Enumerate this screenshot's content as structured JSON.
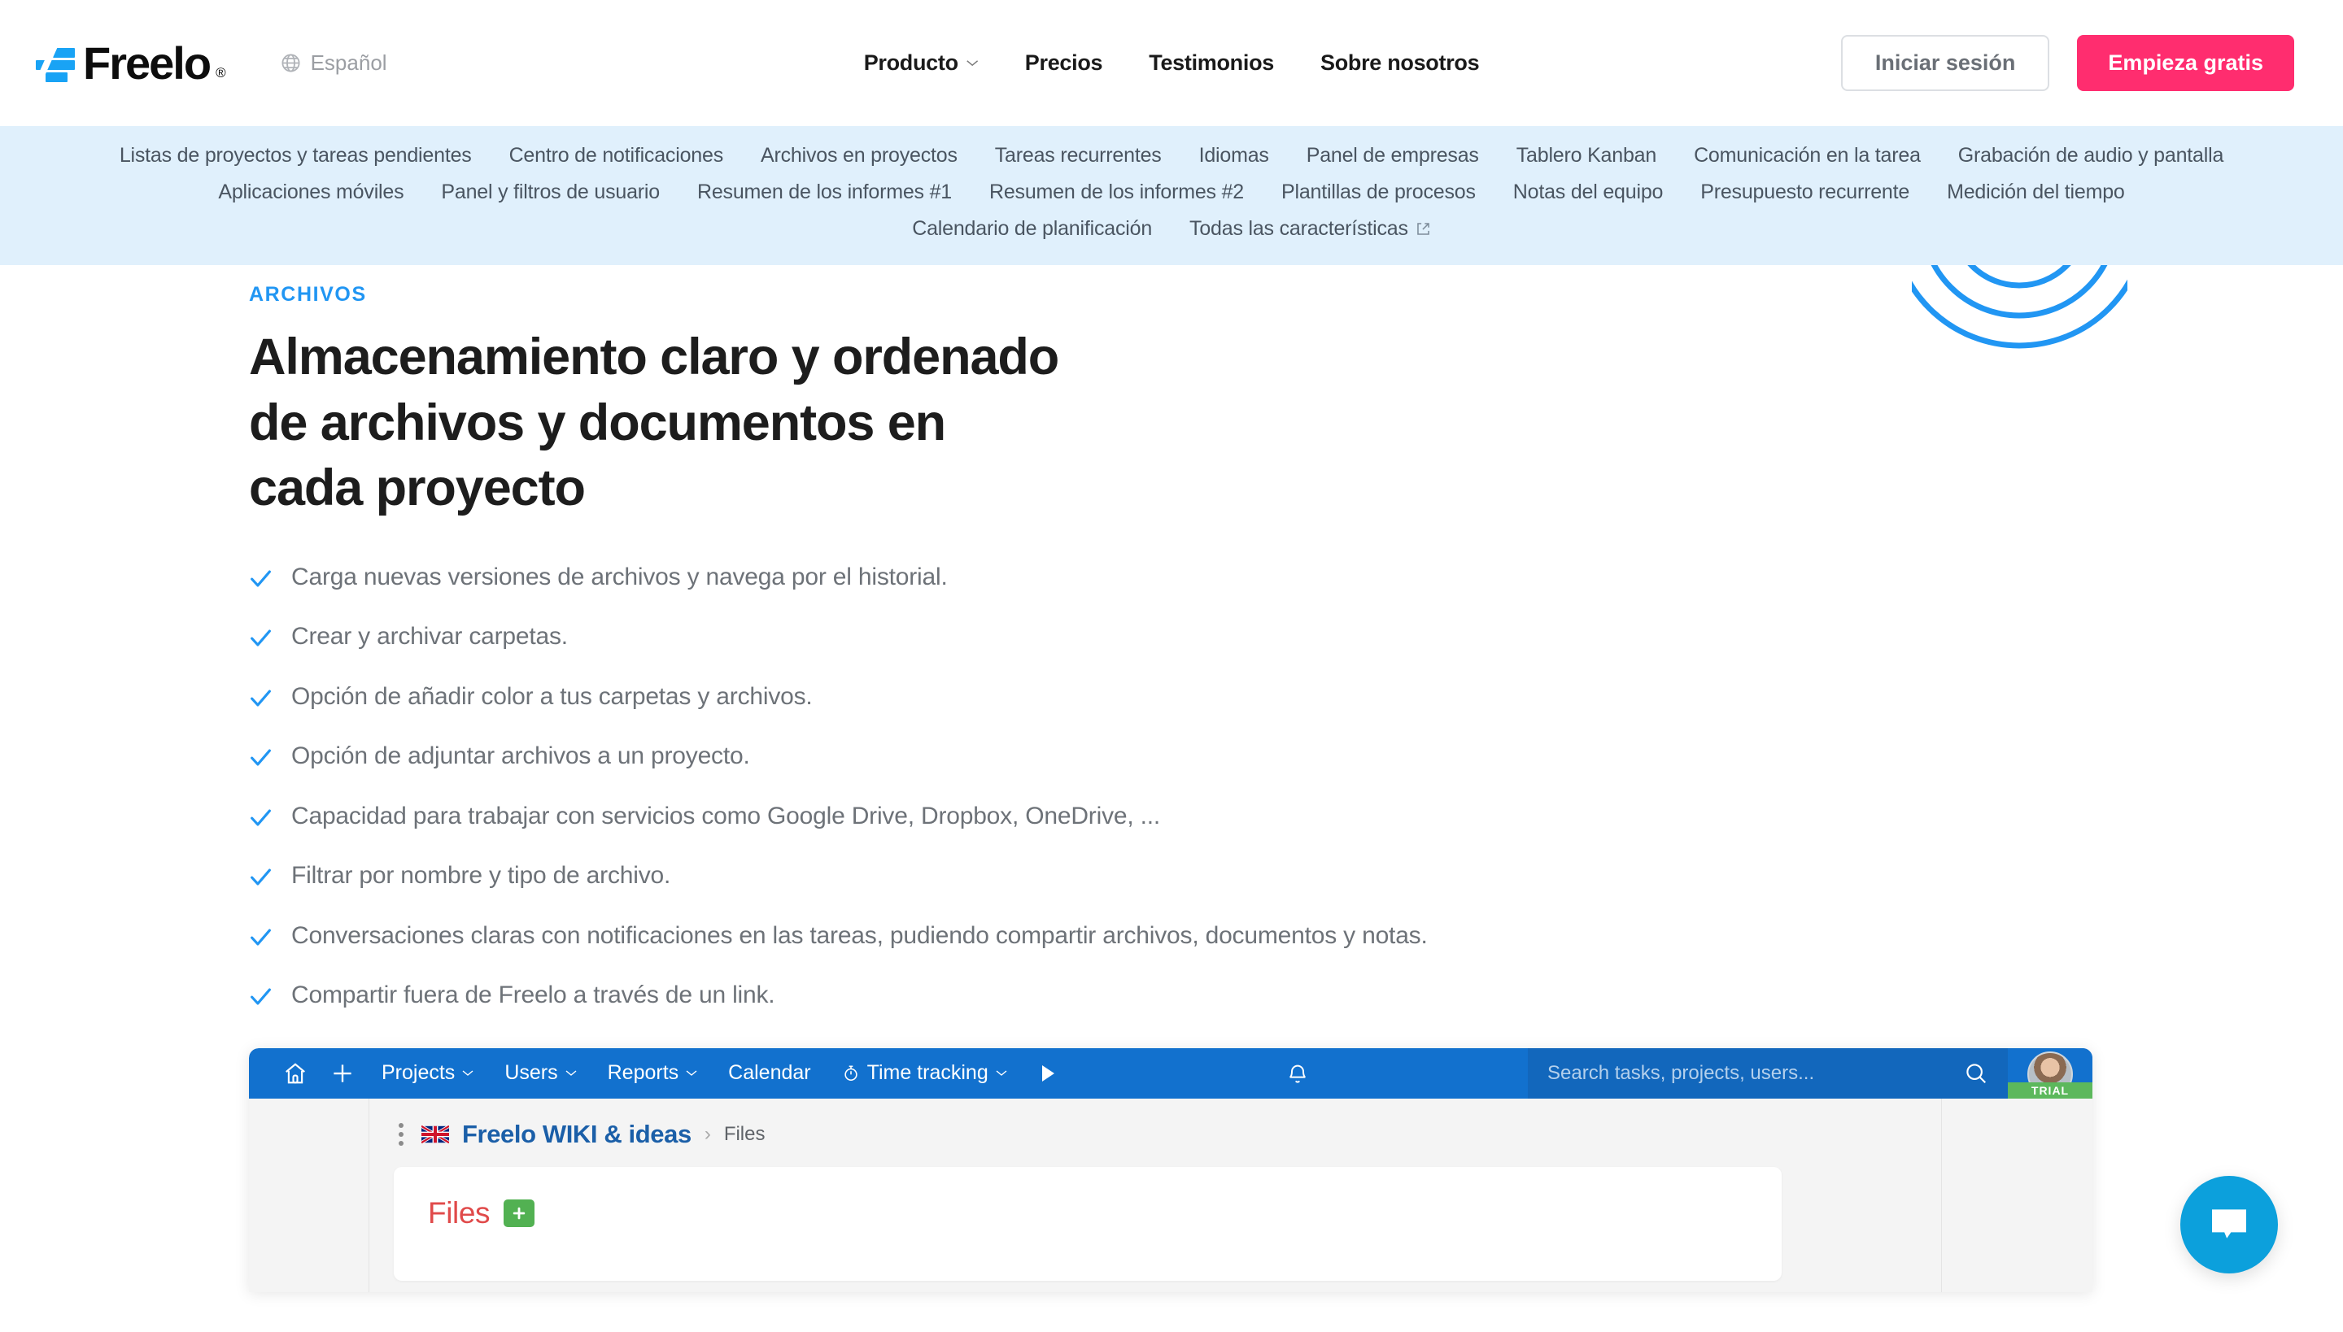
{
  "header": {
    "logo_text": "Freelo",
    "logo_registered": "®",
    "language": "Español",
    "nav": [
      {
        "label": "Producto",
        "has_dropdown": true
      },
      {
        "label": "Precios",
        "has_dropdown": false
      },
      {
        "label": "Testimonios",
        "has_dropdown": false
      },
      {
        "label": "Sobre nosotros",
        "has_dropdown": false
      }
    ],
    "login_label": "Iniciar sesión",
    "cta_label": "Empieza gratis"
  },
  "subnav": {
    "row1": [
      "Listas de proyectos y tareas pendientes",
      "Centro de notificaciones",
      "Archivos en proyectos",
      "Tareas recurrentes",
      "Idiomas",
      "Panel de empresas",
      "Tablero Kanban",
      "Comunicación en la tarea",
      "Grabación de audio y pantalla"
    ],
    "row2": [
      "Aplicaciones móviles",
      "Panel y filtros de usuario",
      "Resumen de los informes #1",
      "Resumen de los informes #2",
      "Plantillas de procesos",
      "Notas del equipo",
      "Presupuesto recurrente",
      "Medición del tiempo"
    ],
    "row3": [
      "Calendario de planificación"
    ],
    "row3_external": "Todas las características"
  },
  "hero": {
    "eyebrow": "ARCHIVOS",
    "title": "Almacenamiento claro y ordenado de archivos y documentos en cada proyecto",
    "features": [
      "Carga nuevas versiones de archivos y navega por el historial.",
      "Crear y archivar carpetas.",
      "Opción de añadir color a tus carpetas y archivos.",
      "Opción de adjuntar archivos a un proyecto.",
      "Capacidad para trabajar con servicios como Google Drive, Dropbox, OneDrive, ...",
      "Filtrar por nombre y tipo de archivo.",
      "Conversaciones claras con notificaciones en las tareas, pudiendo compartir archivos, documentos y notas.",
      "Compartir fuera de Freelo a través de un link."
    ]
  },
  "app": {
    "toolbar": [
      {
        "label": "Projects",
        "dropdown": true
      },
      {
        "label": "Users",
        "dropdown": true
      },
      {
        "label": "Reports",
        "dropdown": true
      },
      {
        "label": "Calendar",
        "dropdown": false
      },
      {
        "label": "Time tracking",
        "dropdown": true
      }
    ],
    "search_placeholder": "Search tasks, projects, users...",
    "trial_badge": "TRIAL",
    "breadcrumb_project": "Freelo WIKI & ideas",
    "breadcrumb_separator": "›",
    "breadcrumb_current": "Files",
    "files_title": "Files"
  },
  "colors": {
    "brand_blue": "#19A3F5",
    "cta_pink": "#FF2D6F",
    "subnav_bg": "#E0F0FC",
    "app_topbar": "#1271CE",
    "accent_eyebrow": "#2196F3",
    "check_blue": "#2196F3",
    "files_red": "#E04A4A",
    "add_green": "#52B152",
    "trial_green": "#5CB85C",
    "chat_blue": "#0CA0DC"
  }
}
